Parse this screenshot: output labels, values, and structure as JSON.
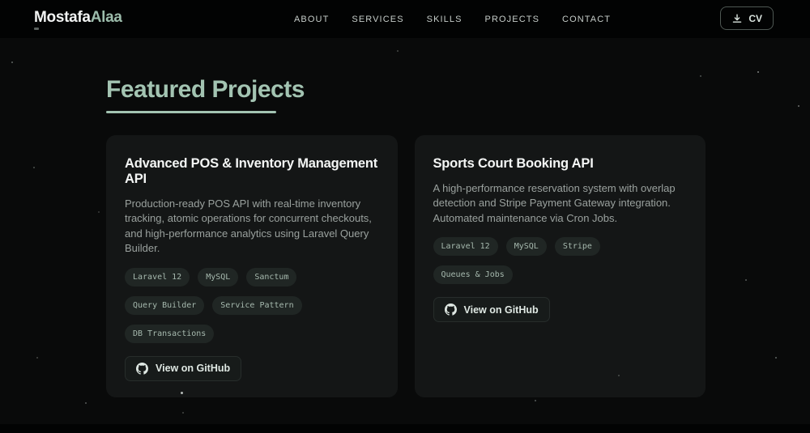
{
  "header": {
    "logo": {
      "first": "Mostafa",
      "last": "Alaa"
    },
    "nav": {
      "about": "ABOUT",
      "services": "SERVICES",
      "skills": "SKILLS",
      "projects": "PROJECTS",
      "contact": "CONTACT"
    },
    "cv_button": {
      "label": "CV",
      "icon": "download-icon"
    }
  },
  "section": {
    "title": "Featured Projects"
  },
  "projects": [
    {
      "title": "Advanced POS & Inventory Management API",
      "description": "Production-ready POS API with real-time inventory tracking, atomic operations for concurrent checkouts, and high-performance analytics using Laravel Query Builder.",
      "tags": [
        "Laravel 12",
        "MySQL",
        "Sanctum",
        "Query Builder",
        "Service Pattern",
        "DB Transactions"
      ],
      "link_label": "View on GitHub",
      "link_icon": "github-icon"
    },
    {
      "title": "Sports Court Booking API",
      "description": "A high-performance reservation system with overlap detection and Stripe Payment Gateway integration. Automated maintenance via Cron Jobs.",
      "tags": [
        "Laravel 12",
        "MySQL",
        "Stripe",
        "Queues & Jobs"
      ],
      "link_label": "View on GitHub",
      "link_icon": "github-icon"
    }
  ],
  "colors": {
    "accent": "#a3c4b2",
    "logo_accent": "#9cbcab",
    "page_background": "#090a0a",
    "header_background": "#020303",
    "card_background": "#141616",
    "tag_text": "#a6b9ae"
  }
}
